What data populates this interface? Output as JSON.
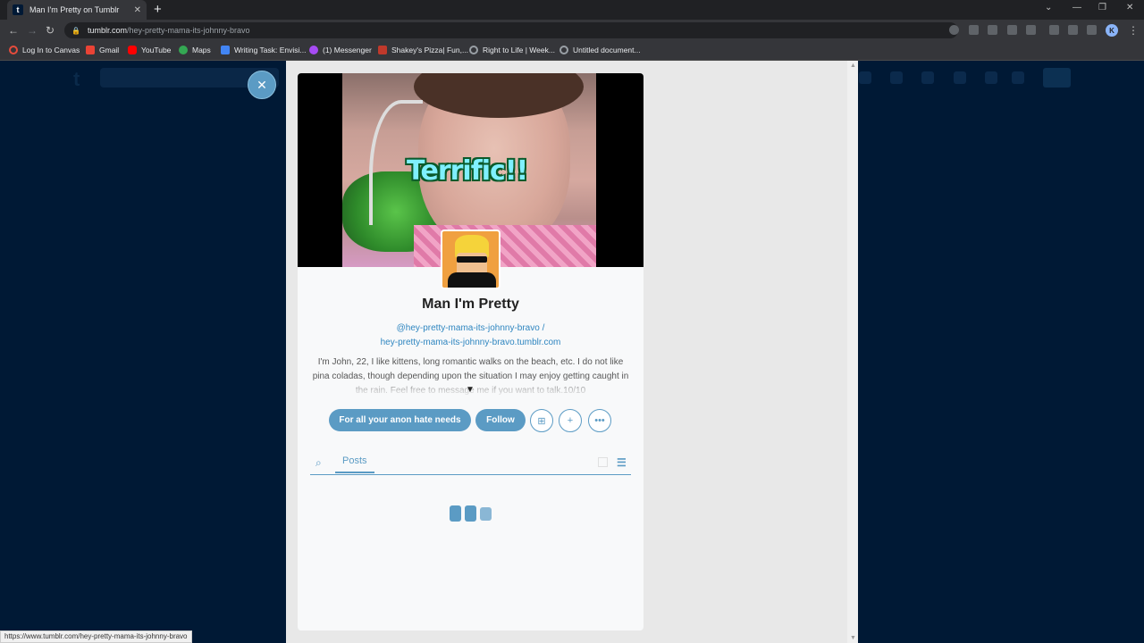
{
  "browser": {
    "tab_title": "Man I'm Pretty on Tumblr",
    "tab_favicon": "t",
    "url_host": "tumblr.com",
    "url_path": "/hey-pretty-mama-its-johnny-bravo",
    "profile_initial": "K",
    "bookmarks": [
      {
        "label": "Log In to Canvas",
        "icon": "canvas-icon",
        "color": "#e74c3c"
      },
      {
        "label": "Gmail",
        "icon": "gmail-icon",
        "color": "#ea4335"
      },
      {
        "label": "YouTube",
        "icon": "youtube-icon",
        "color": "#ff0000"
      },
      {
        "label": "Maps",
        "icon": "maps-icon",
        "color": "#34a853"
      },
      {
        "label": "Writing Task: Envisi...",
        "icon": "docs-icon",
        "color": "#4285f4"
      },
      {
        "label": "(1) Messenger",
        "icon": "messenger-icon",
        "color": "#a64bf4"
      },
      {
        "label": "Shakey's Pizza| Fun,...",
        "icon": "shakeys-icon",
        "color": "#c0392b"
      },
      {
        "label": "Right to Life | Week...",
        "icon": "globe-icon",
        "color": "#9aa0a6"
      },
      {
        "label": "Untitled document...",
        "icon": "globe-icon",
        "color": "#9aa0a6"
      }
    ],
    "status_url": "https://www.tumblr.com/hey-pretty-mama-its-johnny-bravo"
  },
  "blog": {
    "header_caption": "Terrific!!",
    "title": "Man I'm Pretty",
    "handle": "@hey-pretty-mama-its-johnny-bravo /",
    "url": "hey-pretty-mama-its-johnny-bravo.tumblr.com",
    "description": "I'm John, 22, I like kittens, long romantic walks on the beach, etc. I do not like pina coladas, though depending upon the situation I may enjoy getting caught in the rain. Feel free to message me if you want to talk.10/10",
    "buttons": {
      "ask": "For all your anon hate needs",
      "follow": "Follow"
    },
    "tabs": {
      "posts": "Posts"
    }
  },
  "colors": {
    "accent": "#5b9bc4",
    "background": "#001935"
  }
}
